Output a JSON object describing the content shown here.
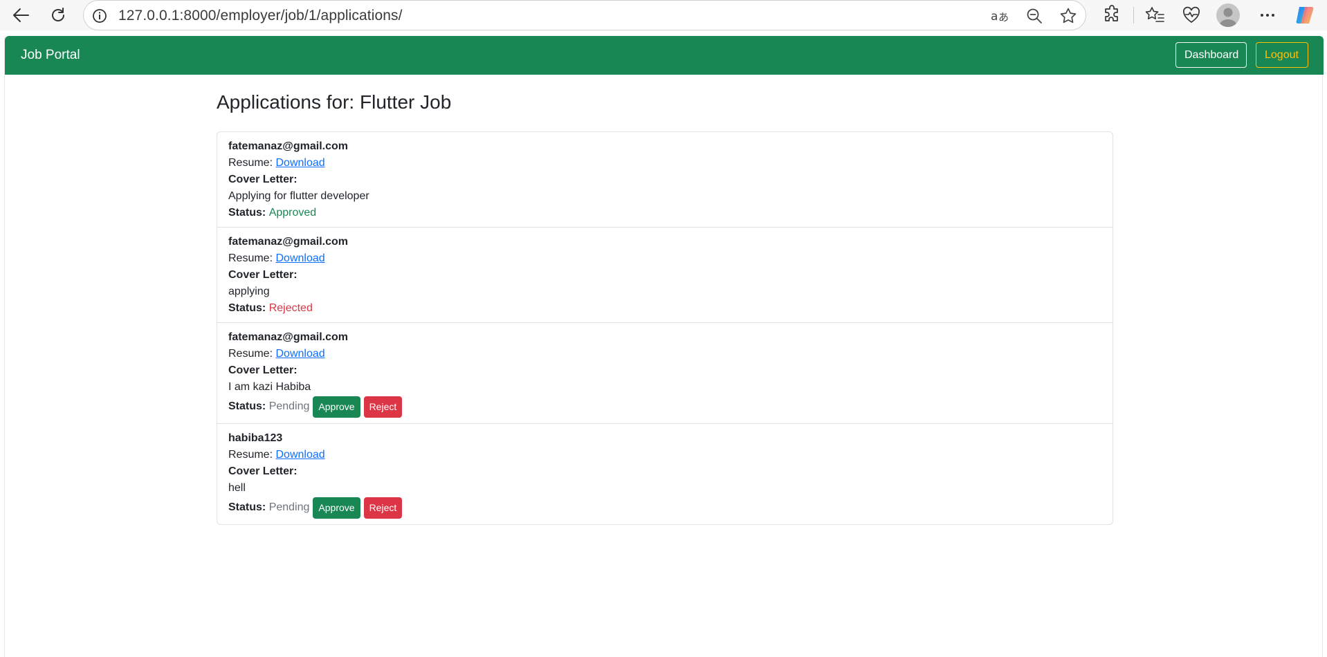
{
  "browser": {
    "url": "127.0.0.1:8000/employer/job/1/applications/"
  },
  "navbar": {
    "brand": "Job Portal",
    "dashboard_label": "Dashboard",
    "logout_label": "Logout"
  },
  "page": {
    "title": "Applications for: Flutter Job"
  },
  "labels": {
    "resume": "Resume:",
    "download": "Download",
    "cover_letter": "Cover Letter:",
    "status": "Status:",
    "approve": "Approve",
    "reject": "Reject"
  },
  "applications": [
    {
      "applicant": "fatemanaz@gmail.com",
      "cover_letter": "Applying for flutter developer",
      "status": "Approved"
    },
    {
      "applicant": "fatemanaz@gmail.com",
      "cover_letter": "applying",
      "status": "Rejected"
    },
    {
      "applicant": "fatemanaz@gmail.com",
      "cover_letter": "I am kazi Habiba",
      "status": "Pending"
    },
    {
      "applicant": "habiba123",
      "cover_letter": "hell",
      "status": "Pending"
    }
  ],
  "colors": {
    "navbar": "#198754",
    "approved": "#198754",
    "rejected": "#dc3545",
    "pending": "#6c757d",
    "link": "#0d6efd",
    "logout": "#ffc107"
  }
}
